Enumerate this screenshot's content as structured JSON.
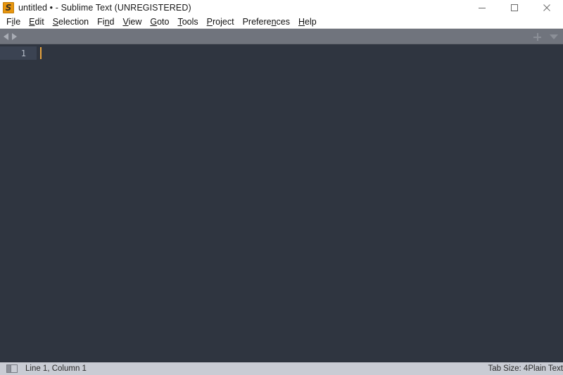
{
  "window": {
    "title": "untitled • - Sublime Text (UNREGISTERED)",
    "icon": "sublime-text-logo-icon",
    "icon_glyph": "S",
    "controls": {
      "minimize": "minimize-icon",
      "maximize": "maximize-icon",
      "close": "close-icon"
    }
  },
  "menubar": {
    "items": [
      {
        "pre": "F",
        "mnemonic": "i",
        "post": "le"
      },
      {
        "pre": "",
        "mnemonic": "E",
        "post": "dit"
      },
      {
        "pre": "",
        "mnemonic": "S",
        "post": "election"
      },
      {
        "pre": "Fi",
        "mnemonic": "n",
        "post": "d"
      },
      {
        "pre": "",
        "mnemonic": "V",
        "post": "iew"
      },
      {
        "pre": "",
        "mnemonic": "G",
        "post": "oto"
      },
      {
        "pre": "",
        "mnemonic": "T",
        "post": "ools"
      },
      {
        "pre": "",
        "mnemonic": "P",
        "post": "roject"
      },
      {
        "pre": "Prefere",
        "mnemonic": "n",
        "post": "ces"
      },
      {
        "pre": "",
        "mnemonic": "H",
        "post": "elp"
      }
    ]
  },
  "tabbar": {
    "nav_prev": "arrow-left-icon",
    "nav_next": "arrow-right-icon",
    "new_tab": "plus-icon",
    "tab_menu": "chevron-down-icon",
    "tabs": []
  },
  "editor": {
    "line_number": "1",
    "content": "",
    "caret_visible": true
  },
  "statusbar": {
    "sidebar_toggle": "sidebar-toggle-icon",
    "position": "Line 1, Column 1",
    "tab_size": "Tab Size: 4",
    "syntax": "Plain Text"
  },
  "colors": {
    "editor_background": "#2f3540",
    "gutter_active": "#3b4352",
    "caret": "#e8a33d",
    "tabbar": "#70747d",
    "statusbar": "#c9ccd4",
    "titlebar": "#ffffff",
    "accent_logo": "#e8960f"
  }
}
